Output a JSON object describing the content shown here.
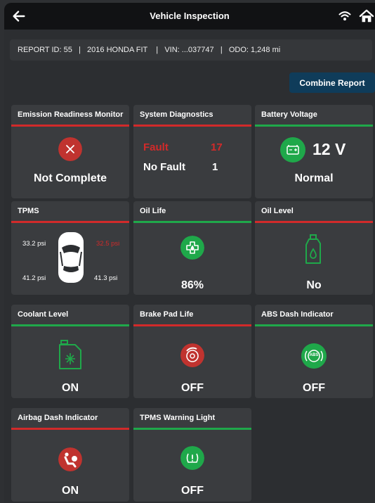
{
  "header": {
    "title": "Vehicle Inspection"
  },
  "info": {
    "report_id": "REPORT ID: 55",
    "vehicle": "2016 HONDA FIT",
    "vin": "VIN: ...037747",
    "odo": "ODO: 1,248 mi",
    "sep": "|"
  },
  "actions": {
    "combine": "Combine Report"
  },
  "emission": {
    "title": "Emission Readiness Monitor",
    "status": "Not Complete"
  },
  "system": {
    "title": "System Diagnostics",
    "fault_label": "Fault",
    "fault_count": "17",
    "nofault_label": "No Fault",
    "nofault_count": "1"
  },
  "battery": {
    "title": "Battery Voltage",
    "value": "12 V",
    "status": "Normal"
  },
  "tpms": {
    "title": "TPMS",
    "fl": "33.2 psi",
    "fr": "32.5 psi",
    "rl": "41.2 psi",
    "rr": "41.3 psi"
  },
  "oil_life": {
    "title": "Oil Life",
    "value": "86%"
  },
  "oil_level": {
    "title": "Oil Level",
    "value": "No"
  },
  "coolant": {
    "title": "Coolant Level",
    "value": "ON"
  },
  "brake": {
    "title": "Brake Pad Life",
    "value": "OFF"
  },
  "abs": {
    "title": "ABS Dash Indicator",
    "value": "OFF",
    "icon_text": "ABS"
  },
  "airbag": {
    "title": "Airbag Dash Indicator",
    "value": "ON"
  },
  "tpms_light": {
    "title": "TPMS Warning Light",
    "value": "OFF"
  },
  "colors": {
    "fault": "#d12a2a",
    "ok": "#1fa84a",
    "accent": "#0f3c5a"
  }
}
